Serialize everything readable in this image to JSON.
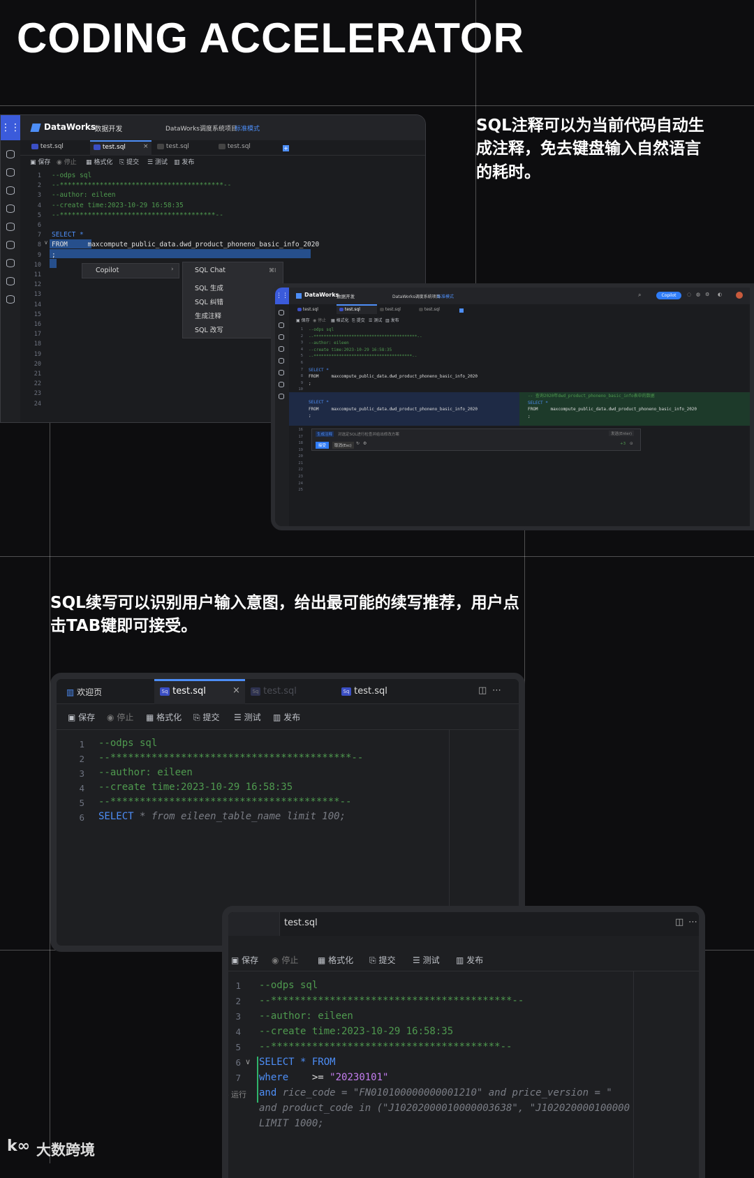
{
  "page": {
    "title": "CODING ACCELERATOR",
    "desc1": "SQL注释可以为当前代码自动生成注释，免去键盘输入自然语言的耗时。",
    "desc2": "SQL续写可以识别用户输入意图，给出最可能的续写推荐，用户点击TAB键即可接受。",
    "logo": "大数跨境"
  },
  "colors": {
    "accent": "#4d8ef7",
    "comment": "#4f9a4f",
    "keyword": "#4d8ef7",
    "string": "#c47ef0",
    "bg": "#0d0d0f"
  },
  "ide1": {
    "app": "DataWorks",
    "module": "数据开发",
    "project": "DataWorks调度系统项目",
    "mode": "标准模式",
    "tabs": [
      "test.sql",
      "test.sql",
      "test.sql",
      "test.sql"
    ],
    "toolbar": [
      "保存",
      "停止",
      "格式化",
      "提交",
      "测试",
      "发布"
    ],
    "lines": [
      "--odps sql",
      "--*****************************************--",
      "--author: eileen",
      "--create time:2023-10-29 16:58:35",
      "--***************************************--",
      "",
      "SELECT *",
      "FROM     maxcompute_public_data.dwd_product_phoneno_basic_info_2020",
      ";"
    ],
    "line_count": 24,
    "context_menu": {
      "item": "Copilot",
      "submenu": [
        "SQL Chat",
        "SQL 生成",
        "SQL 纠错",
        "生成注释",
        "SQL 改写"
      ],
      "shortcut": "⌘I"
    }
  },
  "ide2": {
    "app": "DataWorks",
    "module": "数据开发",
    "project": "DataWorks调度系统项目",
    "mode": "标准模式",
    "copilot": "Copilot",
    "tabs": [
      "test.sql",
      "test.sql",
      "test.sql",
      "test.sql"
    ],
    "toolbar": [
      "保存",
      "停止",
      "格式化",
      "提交",
      "测试",
      "发布"
    ],
    "lines": [
      "--odps sql",
      "--*****************************************--",
      "--author: eileen",
      "--create time:2023-10-29 16:58:35",
      "--***************************************--",
      "",
      "SELECT *",
      "FROM     maxcompute_public_data.dwd_product_phoneno_basic_info_2020",
      ";"
    ],
    "diff_left": [
      "SELECT *",
      "FROM     maxcompute_public_data.dwd_product_phoneno_basic_info_2020",
      ";"
    ],
    "diff_right": [
      "-- 查询2020年dwd_product_phoneno_basic_info表中的数据",
      "SELECT *",
      "FROM     maxcompute_public_data.dwd_product_phoneno_basic_info_2020",
      ";"
    ],
    "prompt_placeholder": "对选定SQL进行检查并给出修改方案",
    "prompt_tag": "生成注释",
    "prompt_button": "发送(Enter)",
    "accept": "接受",
    "cancel": "取消(Esc)",
    "line_count": 25
  },
  "ide3": {
    "tabs": [
      "欢迎页",
      "test.sql",
      "test.sql",
      "test.sql"
    ],
    "toolbar": [
      "保存",
      "停止",
      "格式化",
      "提交",
      "测试",
      "发布"
    ],
    "lines": [
      "--odps sql",
      "--*****************************************--",
      "--author: eileen",
      "--create time:2023-10-29 16:58:35",
      "--***************************************--"
    ],
    "line6_kw": "SELECT",
    "line6_ghost": " * from eileen_table_name limit 100;"
  },
  "ide4": {
    "tab": "test.sql",
    "toolbar": [
      "保存",
      "停止",
      "格式化",
      "提交",
      "测试",
      "发布"
    ],
    "lines": [
      "--odps sql",
      "--*****************************************--",
      "--author: eileen",
      "--create time:2023-10-29 16:58:35",
      "--***************************************--"
    ],
    "line6": "SELECT * FROM",
    "line7_kw": "where",
    "line7_op": "    >= ",
    "line7_str": "\"20230101\"",
    "line8_kw": "and",
    "line8_ghost": " rice_code = \"FN010100000000001210\" and price_version = \"",
    "ghost2": "and product_code in (\"J10202000010000003638\", \"J102020000100000",
    "ghost3": "LIMIT 1000;",
    "run": "运行"
  }
}
